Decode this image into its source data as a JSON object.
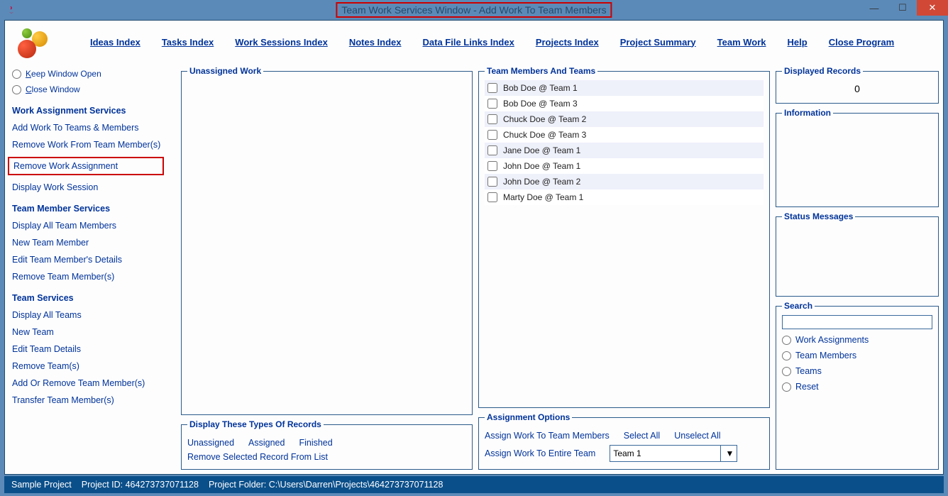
{
  "window": {
    "title": "Team Work Services Window - Add Work To Team Members"
  },
  "menu": {
    "ideas": "Ideas Index",
    "tasks": "Tasks Index",
    "work_sessions": "Work Sessions Index",
    "notes": "Notes Index",
    "data_file": "Data File Links Index",
    "projects": "Projects Index",
    "proj_summary": "Project Summary",
    "team_work": "Team Work",
    "help": "Help",
    "close_prog": "Close Program"
  },
  "sidebar": {
    "keep_open": "Keep Window Open",
    "close_win": "Close Window",
    "sec_work": "Work Assignment Services",
    "add_work": "Add Work To Teams & Members",
    "remove_from_members": "Remove Work From Team Member(s)",
    "remove_assign": "Remove Work Assignment",
    "display_session": "Display Work Session",
    "sec_member": "Team Member Services",
    "display_members": "Display All Team Members",
    "new_member": "New Team Member",
    "edit_member": "Edit Team Member's Details",
    "remove_members": "Remove Team Member(s)",
    "sec_team": "Team Services",
    "display_teams": "Display All Teams",
    "new_team": "New Team",
    "edit_team": "Edit Team Details",
    "remove_teams": "Remove Team(s)",
    "add_remove": "Add Or Remove Team Member(s)",
    "transfer": "Transfer Team Member(s)"
  },
  "unassigned": {
    "legend": "Unassigned Work"
  },
  "display_types": {
    "legend": "Display These Types Of Records",
    "unassigned": "Unassigned",
    "assigned": "Assigned",
    "finished": "Finished",
    "remove_selected": "Remove Selected Record From List"
  },
  "members": {
    "legend": "Team Members And Teams",
    "list": [
      "Bob Doe @ Team 1",
      "Bob Doe @ Team 3",
      "Chuck Doe @ Team 2",
      "Chuck Doe @ Team 3",
      "Jane Doe @ Team 1",
      "John Doe @ Team 1",
      "John Doe @ Team 2",
      "Marty Doe @ Team 1"
    ]
  },
  "assign_opts": {
    "legend": "Assignment Options",
    "to_members": "Assign Work To Team Members",
    "select_all": "Select All",
    "unselect_all": "Unselect All",
    "to_team": "Assign Work To Entire Team",
    "selected_team": "Team 1"
  },
  "displayed": {
    "legend": "Displayed Records",
    "count": "0"
  },
  "info": {
    "legend": "Information"
  },
  "status": {
    "legend": "Status Messages"
  },
  "search": {
    "legend": "Search",
    "work_assign": "Work Assignments",
    "team_members": "Team Members",
    "teams": "Teams",
    "reset": "Reset"
  },
  "statusbar": {
    "project": "Sample Project",
    "project_id": "Project ID: 464273737071128",
    "folder": "Project Folder: C:\\Users\\Darren\\Projects\\464273737071128"
  }
}
